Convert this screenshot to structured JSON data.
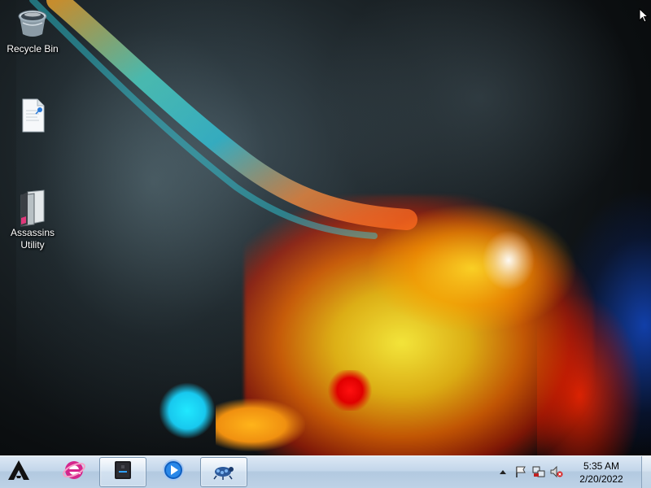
{
  "desktop": {
    "icons": [
      {
        "label": "Recycle Bin",
        "icon": "recycle-bin-icon"
      },
      {
        "label": "",
        "icon": "text-document-icon"
      },
      {
        "label": "Assassins Utility",
        "icon": "folder-utility-icon"
      }
    ]
  },
  "taskbar": {
    "start_button": {
      "icon": "start-logo-icon"
    },
    "pinned": [
      {
        "icon": "internet-explorer-icon",
        "active": false
      },
      {
        "icon": "drive-manager-icon",
        "active": true
      },
      {
        "icon": "media-player-icon",
        "active": false
      },
      {
        "icon": "network-bug-icon",
        "active": true
      }
    ],
    "tray": {
      "icons": [
        "show-hidden-icons-arrow",
        "action-center-flag-icon",
        "network-icon",
        "volume-muted-icon"
      ],
      "clock": {
        "time": "5:35 AM",
        "date": "2/20/2022"
      }
    }
  },
  "colors": {
    "taskbar_top": "#dce8f4",
    "taskbar_bottom": "#bed2e6",
    "label_text": "#ffffff"
  }
}
